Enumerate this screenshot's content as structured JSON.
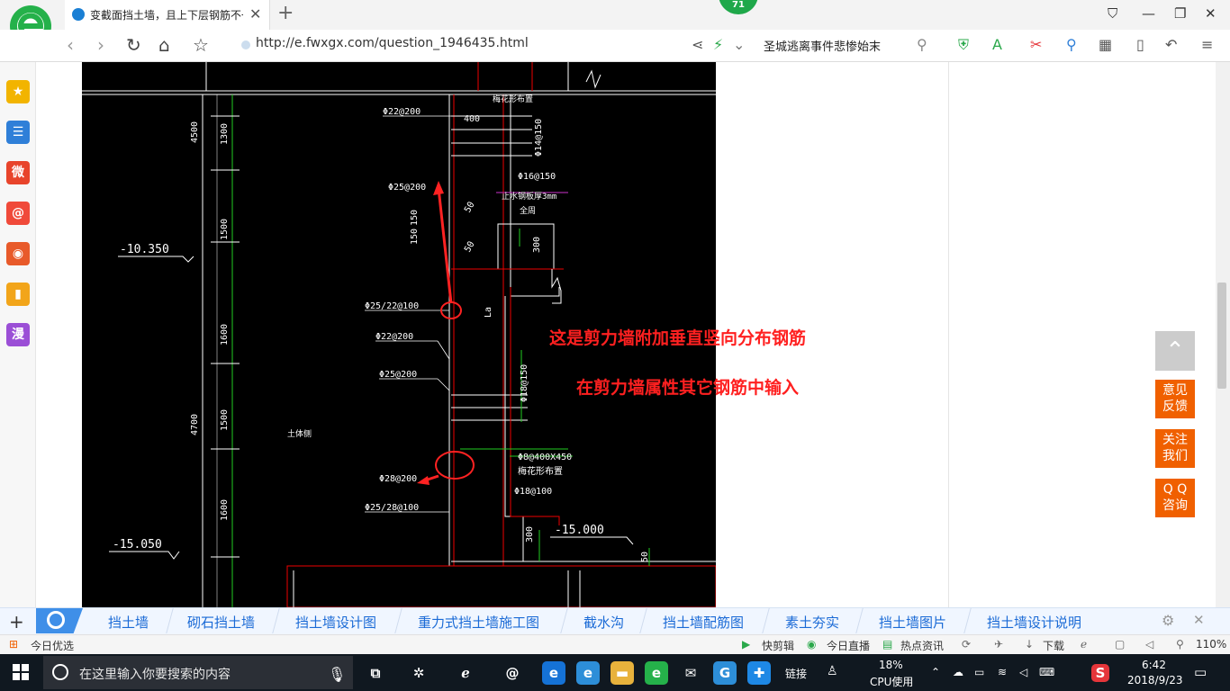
{
  "browser": {
    "tab_title": "变截面挡土墙，且上下层钢筋不一",
    "tab_close": "✕",
    "new_tab": "+",
    "badge_count": "71",
    "url": "http://e.fwxgx.com/question_1946435.html",
    "search_text": "圣城逃离事件悲惨始末"
  },
  "sidebar": {
    "items": [
      {
        "icon": "star-icon",
        "glyph": "★",
        "color": "#f2b400"
      },
      {
        "icon": "news-icon",
        "glyph": "☰",
        "color": "#2f7fd8"
      },
      {
        "icon": "weibo-icon",
        "glyph": "微",
        "color": "#e8442b"
      },
      {
        "icon": "mail-icon",
        "glyph": "@",
        "color": "#f04a3a"
      },
      {
        "icon": "game-icon",
        "glyph": "◉",
        "color": "#e85a2a"
      },
      {
        "icon": "book-icon",
        "glyph": "▮",
        "color": "#f2a51a"
      },
      {
        "icon": "manga-icon",
        "glyph": "漫",
        "color": "#9b4fd6"
      }
    ]
  },
  "drawing": {
    "labels": {
      "dim_4500": "4500",
      "dim_1300": "1300",
      "dim_1500a": "1500",
      "dim_1600a": "1600",
      "dim_4700": "4700",
      "dim_1500b": "1500",
      "dim_1600b": "1600",
      "elev_top": "-10.350",
      "elev_bottom": "-15.050",
      "elev_right": "-15.000",
      "r_22_200": "Φ22@200",
      "r_400": "400",
      "r_14_150": "Φ14@150",
      "r_16_150": "Φ16@150",
      "r_25_200a": "Φ25@200",
      "r_waterstop": "止水钢板厚3mm",
      "r_full": "全周",
      "r_150a": "150",
      "r_150b": "150",
      "r_50a": "50",
      "r_50b": "50",
      "r_300": "300",
      "r_25_22_100": "Φ25/22@100",
      "r_22_200b": "Φ22@200",
      "r_25_200b": "Φ25@200",
      "r_18_150": "Φ18@150",
      "r_La": "La",
      "soil": "土体侧",
      "r_8_400x450": "Φ8@400X450",
      "r_plum": "梅花形布置",
      "r_28_200": "Φ28@200",
      "r_18_100": "Φ18@100",
      "r_25_28_100": "Φ25/28@100",
      "r_300b": "300",
      "r_50c": "50",
      "r_top_cut": "梅花形布置"
    },
    "annotation_1": "这是剪力墙附加垂直竖向分布钢筋",
    "annotation_2": "在剪力墙属性其它钢筋中输入"
  },
  "float_buttons": {
    "to_top": "⌃",
    "feedback": [
      "意见",
      "反馈"
    ],
    "follow": [
      "关注",
      "我们"
    ],
    "qq": [
      "Q Q",
      "咨询"
    ]
  },
  "tagbar": {
    "tags": [
      "挡土墙",
      "砌石挡土墙",
      "挡土墙设计图",
      "重力式挡土墙施工图",
      "截水沟",
      "挡土墙配筋图",
      "素土夯实",
      "挡土墙图片",
      "挡土墙设计说明"
    ]
  },
  "statusbar": {
    "left": "今日优选",
    "items": [
      "快剪辑",
      "今日直播",
      "热点资讯",
      "下载"
    ],
    "zoom": "110%"
  },
  "taskbar": {
    "search_placeholder": "在这里输入你要搜索的内容",
    "link_label": "链接",
    "cpu_percent": "18%",
    "cpu_label": "CPU使用",
    "time": "6:42",
    "date": "2018/9/23"
  }
}
